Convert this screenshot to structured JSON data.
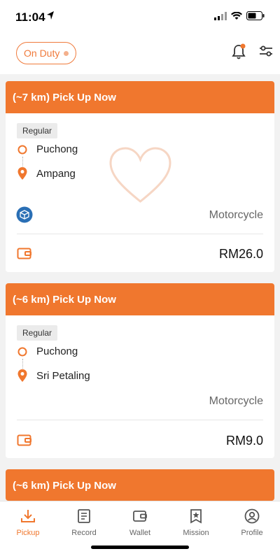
{
  "status": {
    "time": "11:04"
  },
  "top": {
    "duty_label": "On Duty"
  },
  "orders": [
    {
      "header": "(~7 km) Pick Up Now",
      "tag": "Regular",
      "pickup": "Puchong",
      "dropoff": "Ampang",
      "vehicle": "Motorcycle",
      "price": "RM26.0"
    },
    {
      "header": "(~6 km) Pick Up Now",
      "tag": "Regular",
      "pickup": "Puchong",
      "dropoff": "Sri Petaling",
      "vehicle": "Motorcycle",
      "price": "RM9.0"
    },
    {
      "header": "(~6 km) Pick Up Now"
    }
  ],
  "tabs": [
    {
      "label": "Pickup",
      "icon": "download-icon",
      "active": true
    },
    {
      "label": "Record",
      "icon": "record-icon"
    },
    {
      "label": "Wallet",
      "icon": "wallet-icon"
    },
    {
      "label": "Mission",
      "icon": "mission-icon"
    },
    {
      "label": "Profile",
      "icon": "profile-icon"
    }
  ],
  "colors": {
    "accent": "#f0772e",
    "background": "#f2f2f2"
  }
}
